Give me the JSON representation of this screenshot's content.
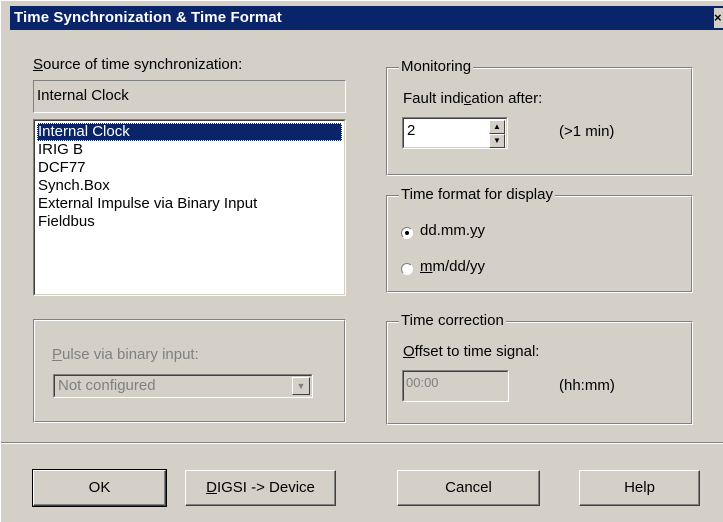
{
  "window": {
    "title": "Time Synchronization & Time Format",
    "close_glyph": "×"
  },
  "source": {
    "label": "Source of time synchronization:",
    "current_value": "Internal Clock",
    "options": [
      "Internal Clock",
      "IRIG B",
      "DCF77",
      "Synch.Box",
      "External Impulse via Binary Input",
      "Fieldbus"
    ],
    "selected_index": 0
  },
  "monitoring": {
    "legend": "Monitoring",
    "fault_label": "Fault indication after:",
    "value": "2",
    "unit": "(>1 min)"
  },
  "time_format": {
    "legend": "Time format for display",
    "options": [
      {
        "label": "dd.mm.yy",
        "selected": true
      },
      {
        "label": "mm/dd/yy",
        "selected": false
      }
    ]
  },
  "pulse": {
    "label": "Pulse via binary input:",
    "value": "Not configured"
  },
  "time_correction": {
    "legend": "Time correction",
    "offset_label": "Offset to time signal:",
    "value": "00:00",
    "unit": "(hh:mm)"
  },
  "buttons": {
    "ok": "OK",
    "digsi": "DIGSI -> Device",
    "cancel": "Cancel",
    "help": "Help"
  }
}
